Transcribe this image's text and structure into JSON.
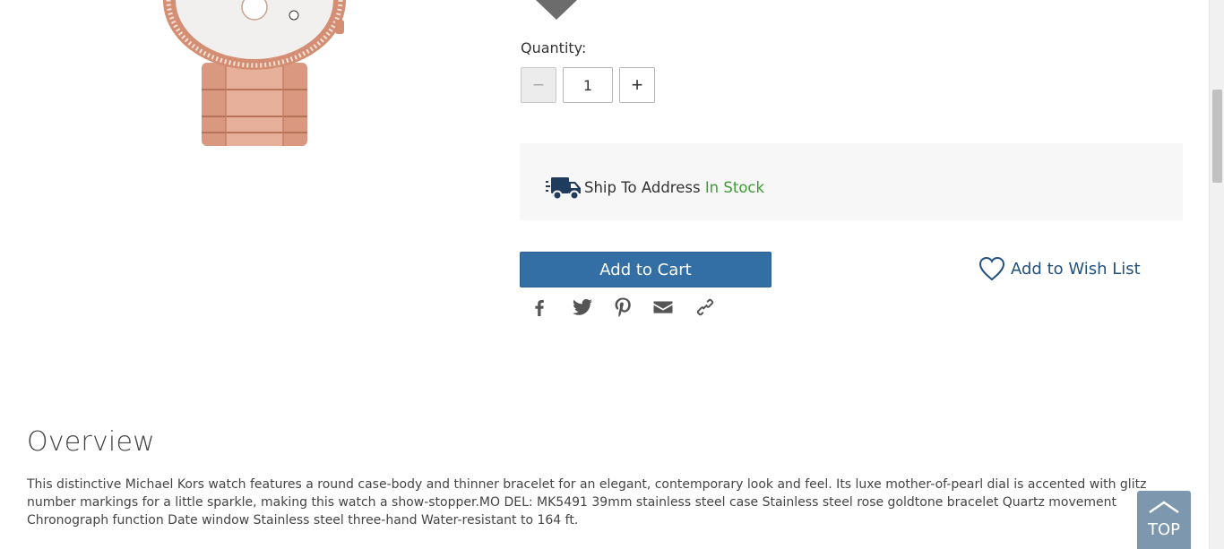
{
  "product": {
    "quantity_label": "Quantity:",
    "quantity_value": "1",
    "minus_symbol": "−",
    "plus_symbol": "+"
  },
  "shipping": {
    "method_label": "Ship To Address",
    "stock_status": "In Stock",
    "stock_color": "#3f9c35",
    "icon": "truck-icon"
  },
  "actions": {
    "add_to_cart": "Add to Cart",
    "wish_list": "Add to Wish List",
    "primary_color": "#336ea4"
  },
  "share": {
    "icons": [
      "facebook-icon",
      "twitter-icon",
      "pinterest-icon",
      "email-icon",
      "link-icon"
    ]
  },
  "overview": {
    "title": "Overview",
    "text": "This distinctive Michael Kors watch features a round case-body and thinner bracelet for an elegant, contemporary look and feel. Its luxe mother-of-pearl dial is accented with glitz number markings for a little sparkle, making this watch a show-stopper.MO DEL: MK5491 39mm stainless steel case Stainless steel rose goldtone bracelet Quartz movement Chronograph function Date window Stainless steel three-hand Water-resistant to 164 ft."
  },
  "back_to_top": {
    "label": "TOP"
  }
}
